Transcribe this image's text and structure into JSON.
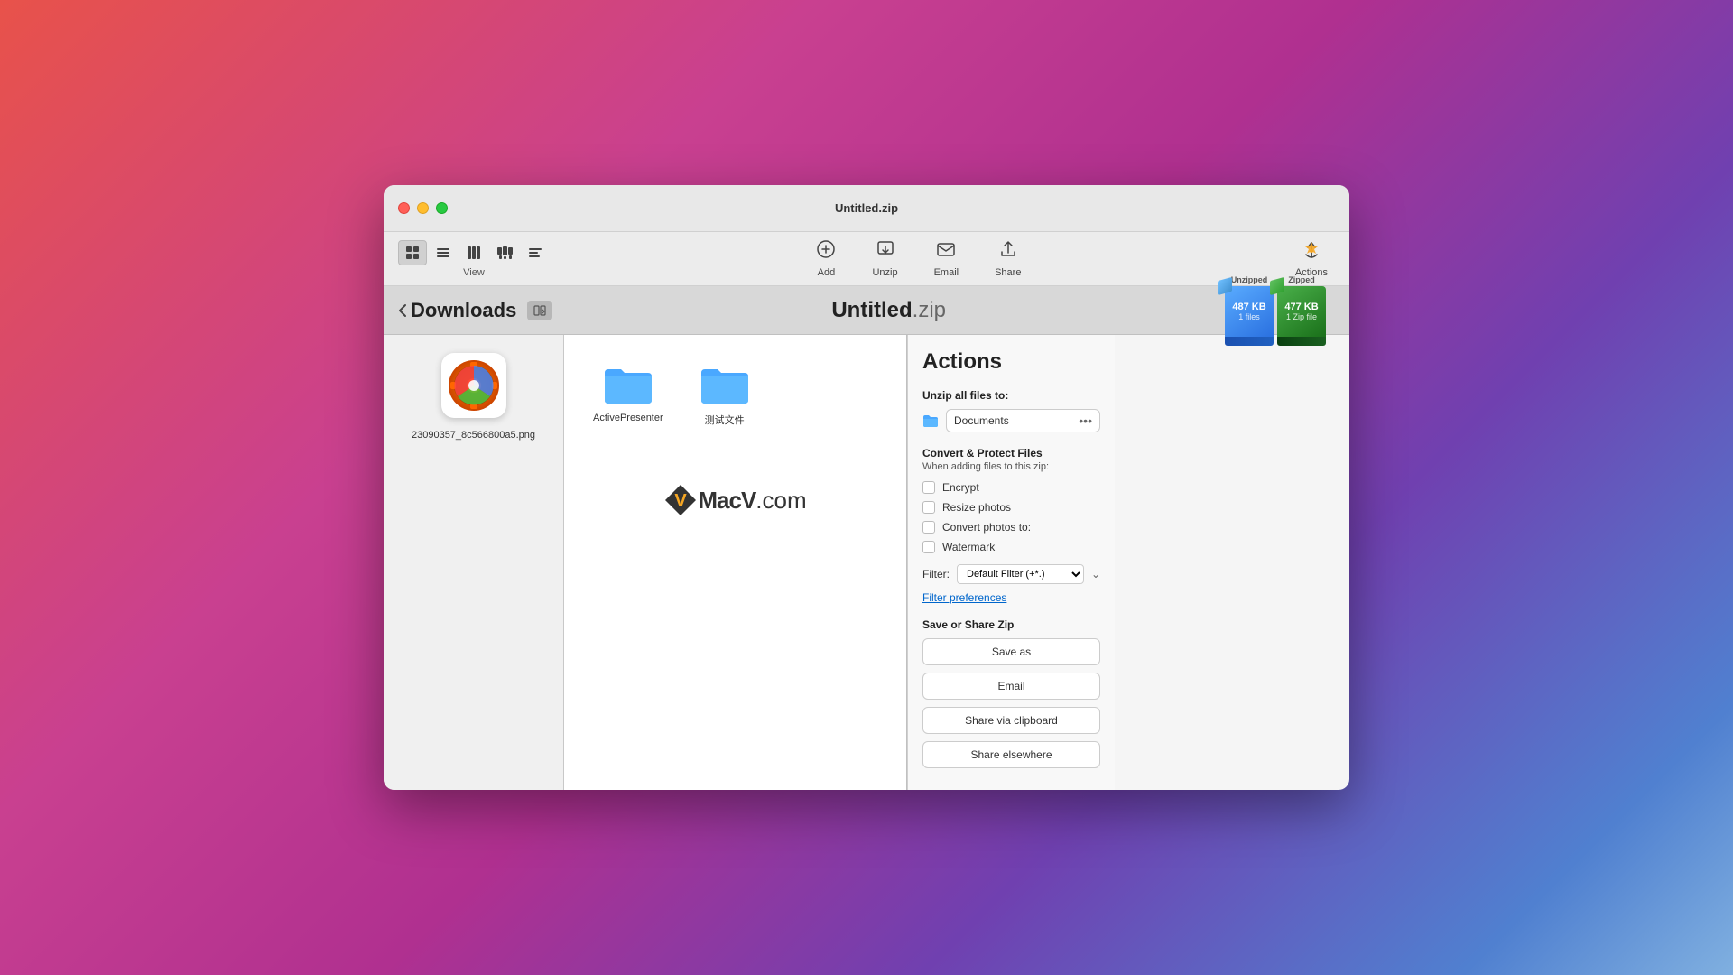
{
  "window": {
    "title": "Untitled.zip"
  },
  "toolbar": {
    "view_label": "View",
    "add_label": "Add",
    "unzip_label": "Unzip",
    "email_label": "Email",
    "share_label": "Share",
    "actions_label": "Actions"
  },
  "navbar": {
    "back_label": "Downloads",
    "zip_name": "Untitled",
    "zip_ext": ".zip",
    "unzipped_label": "Unzipped",
    "zipped_label": "Zipped",
    "unzipped_size": "487 KB",
    "unzipped_files": "1 files",
    "zipped_size": "477 KB",
    "zipped_files": "1 Zip file"
  },
  "source_panel": {
    "file_name": "23090357_8c566800a5.png"
  },
  "zip_contents": {
    "items": [
      {
        "name": "ActivePresenter",
        "type": "folder"
      },
      {
        "name": "测试文件",
        "type": "folder"
      }
    ],
    "logo": {
      "text1": "MacV",
      "text2": ".com"
    }
  },
  "actions_panel": {
    "title": "Actions",
    "unzip_section_label": "Unzip all files to:",
    "unzip_destination": "Documents",
    "ellipsis": "•••",
    "convert_title": "Convert & Protect Files",
    "convert_subtitle": "When adding files to this zip:",
    "checkboxes": [
      {
        "label": "Encrypt",
        "checked": false
      },
      {
        "label": "Resize photos",
        "checked": false
      },
      {
        "label": "Convert photos to:",
        "checked": false
      },
      {
        "label": "Watermark",
        "checked": false
      }
    ],
    "filter_label": "Filter:",
    "filter_value": "Default Filter (+*.)",
    "filter_link": "Filter preferences",
    "save_share_title": "Save or Share Zip",
    "save_as_label": "Save as",
    "email_label": "Email",
    "share_clipboard_label": "Share via clipboard",
    "share_elsewhere_label": "Share elsewhere"
  }
}
